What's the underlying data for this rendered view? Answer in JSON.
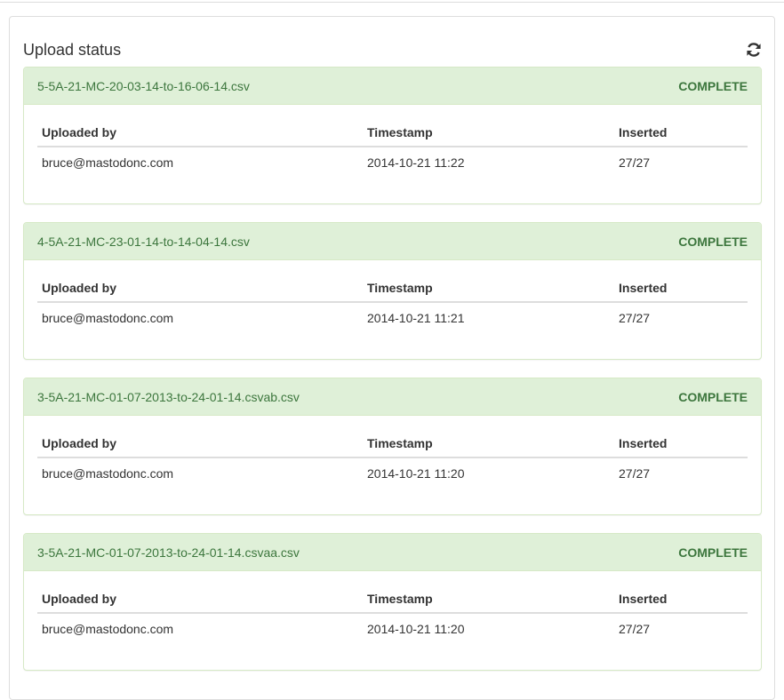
{
  "panel": {
    "title": "Upload status",
    "refresh_icon": "refresh-icon"
  },
  "colors": {
    "success_bg": "#dff0d8",
    "success_text": "#3c763d",
    "success_border": "#d6e9c6"
  },
  "columns": {
    "uploaded_by": "Uploaded by",
    "timestamp": "Timestamp",
    "inserted": "Inserted"
  },
  "uploads": [
    {
      "file": "5-5A-21-MC-20-03-14-to-16-06-14.csv",
      "status": "COMPLETE",
      "uploaded_by": "bruce@mastodonc.com",
      "timestamp": "2014-10-21 11:22",
      "inserted": "27/27"
    },
    {
      "file": "4-5A-21-MC-23-01-14-to-14-04-14.csv",
      "status": "COMPLETE",
      "uploaded_by": "bruce@mastodonc.com",
      "timestamp": "2014-10-21 11:21",
      "inserted": "27/27"
    },
    {
      "file": "3-5A-21-MC-01-07-2013-to-24-01-14.csvab.csv",
      "status": "COMPLETE",
      "uploaded_by": "bruce@mastodonc.com",
      "timestamp": "2014-10-21 11:20",
      "inserted": "27/27"
    },
    {
      "file": "3-5A-21-MC-01-07-2013-to-24-01-14.csvaa.csv",
      "status": "COMPLETE",
      "uploaded_by": "bruce@mastodonc.com",
      "timestamp": "2014-10-21 11:20",
      "inserted": "27/27"
    }
  ]
}
